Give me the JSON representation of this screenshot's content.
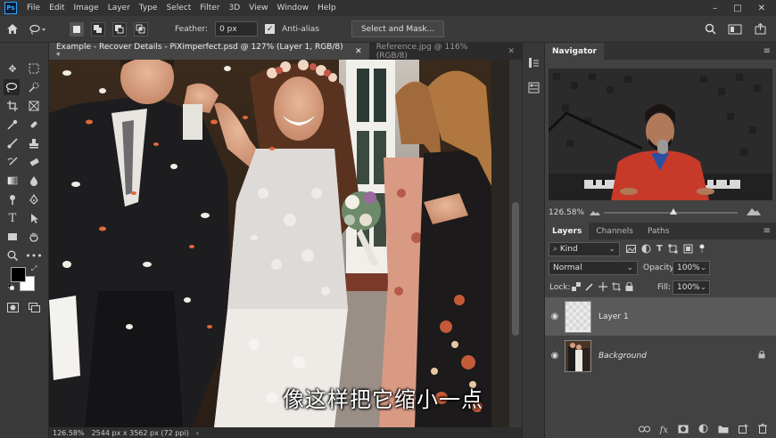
{
  "menubar": {
    "logo": "Ps",
    "items": [
      "File",
      "Edit",
      "Image",
      "Layer",
      "Type",
      "Select",
      "Filter",
      "3D",
      "View",
      "Window",
      "Help"
    ],
    "window_controls": [
      "–",
      "□",
      "✕"
    ]
  },
  "options": {
    "feather_label": "Feather:",
    "feather_value": "0 px",
    "antialias_label": "Anti-alias",
    "select_mask_label": "Select and Mask..."
  },
  "tabs": [
    {
      "label": "Example - Recover Details - PiXimperfect.psd @ 127% (Layer 1, RGB/8) *",
      "close": "✕"
    },
    {
      "label": "Reference.jpg @ 116% (RGB/8)",
      "close": "✕"
    }
  ],
  "status": {
    "zoom": "126.58%",
    "doc_info": "2544 px x 3562 px (72 ppi)",
    "arrow": "›"
  },
  "subtitle": "像这样把它缩小一点",
  "navigator": {
    "title": "Navigator",
    "zoom": "126.58%"
  },
  "layers_panel": {
    "tabs": [
      "Layers",
      "Channels",
      "Paths"
    ],
    "filter_kind": "Kind",
    "blend_mode": "Normal",
    "opacity_label": "Opacity:",
    "opacity_value": "100%",
    "lock_label": "Lock:",
    "fill_label": "Fill:",
    "fill_value": "100%",
    "layers": [
      {
        "name": "Layer 1",
        "selected": true,
        "visible": true
      },
      {
        "name": "Background",
        "selected": false,
        "visible": true,
        "locked": true
      }
    ]
  },
  "colors": {
    "accent": "#31a8ff",
    "foreground": "#000000",
    "background": "#ffffff",
    "panel_bg": "#424242",
    "selected_layer": "#5a5a5a"
  }
}
